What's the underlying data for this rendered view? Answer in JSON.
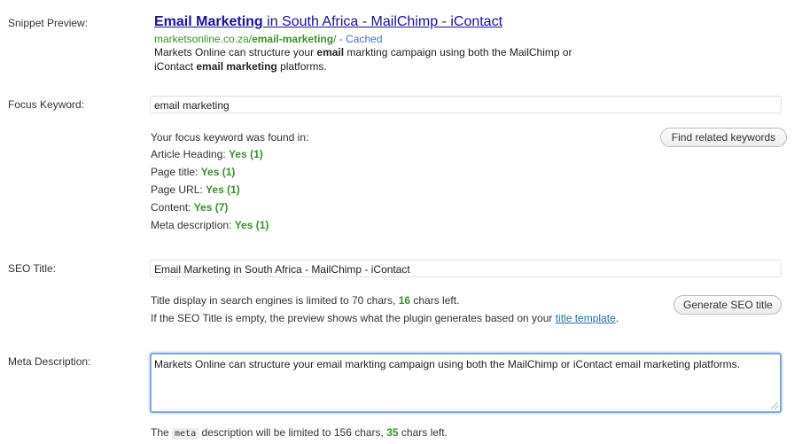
{
  "snippet": {
    "label": "Snippet Preview:",
    "title_bold": "Email Marketing",
    "title_rest": " in South Africa - MailChimp - iContact",
    "url_domain": "marketsonline.co.za/",
    "url_bold": "email-marketing",
    "url_slash": "/",
    "url_sep": " - ",
    "cached": "Cached",
    "desc_1": "Markets Online can structure your ",
    "desc_b1": "email",
    "desc_2": " markting campaign using both the MailChimp or",
    "desc_3": "iContact ",
    "desc_b2": "email marketing",
    "desc_4": " platforms."
  },
  "focus": {
    "label": "Focus Keyword:",
    "value": "email marketing",
    "found_intro": "Your focus keyword was found in:",
    "find_button": "Find related keywords",
    "results": [
      {
        "label": "Article Heading: ",
        "value": "Yes (1)"
      },
      {
        "label": "Page title: ",
        "value": "Yes (1)"
      },
      {
        "label": "Page URL: ",
        "value": "Yes (1)"
      },
      {
        "label": "Content: ",
        "value": "Yes (7)"
      },
      {
        "label": "Meta description: ",
        "value": "Yes (1)"
      }
    ]
  },
  "seo_title": {
    "label": "SEO Title:",
    "value": "Email Marketing in South Africa - MailChimp - iContact",
    "info_1": "Title display in search engines is limited to 70 chars, ",
    "chars_left": "16",
    "info_2": " chars left.",
    "note_1": "If the SEO Title is empty, the preview shows what the plugin generates based on your ",
    "note_link": "title template",
    "note_2": ".",
    "generate_button": "Generate SEO title"
  },
  "meta": {
    "label": "Meta Description:",
    "value": "Markets Online can structure your email markting campaign using both the MailChimp or iContact email marketing platforms.",
    "info_1": "The ",
    "code": "meta",
    "info_2": " description will be limited to 156 chars, ",
    "chars_left": "35",
    "info_3": " chars left."
  }
}
